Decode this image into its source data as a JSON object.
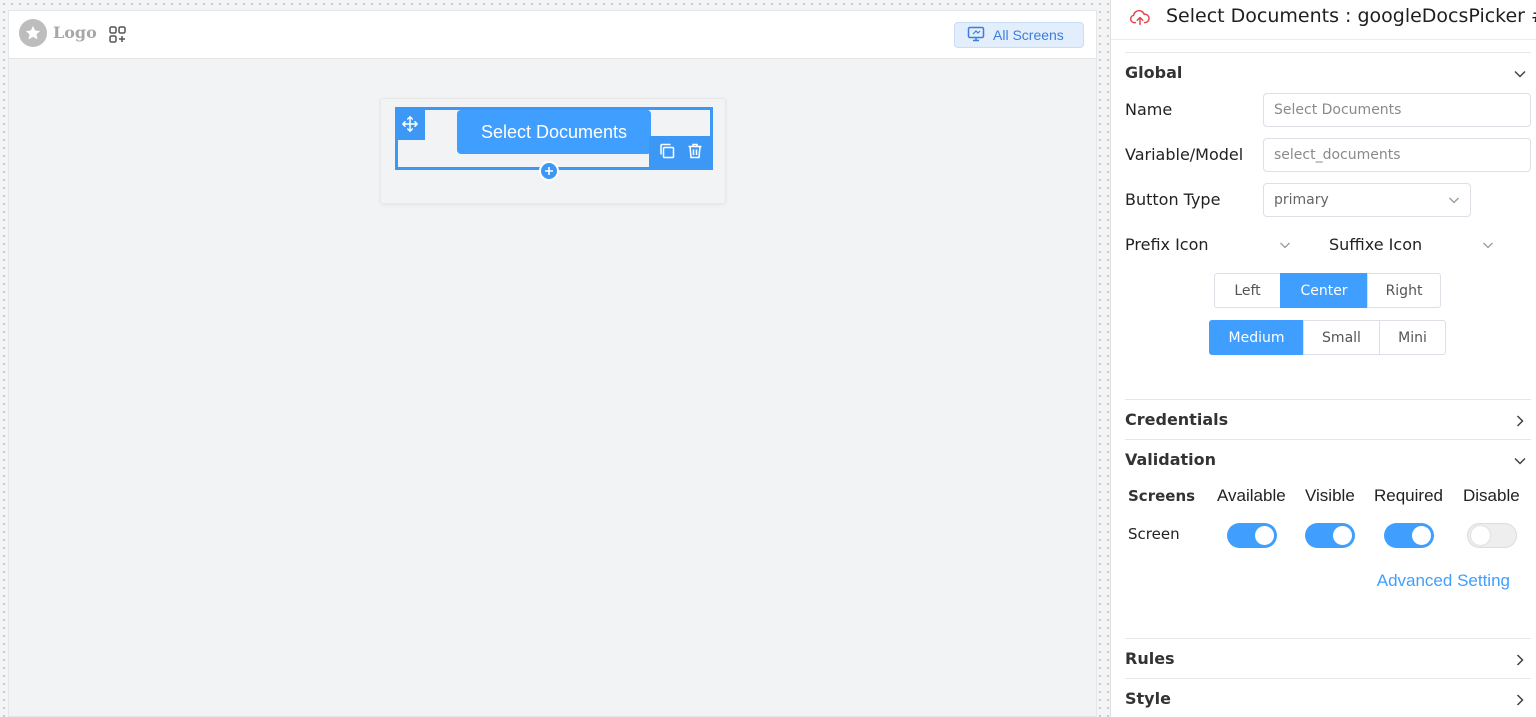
{
  "canvas": {
    "logo_text": "Logo",
    "all_screens_label": "All Screens",
    "widget_button_label": "Select Documents"
  },
  "panel": {
    "title": "Select Documents : googleDocsPicker #s",
    "global": {
      "header": "Global",
      "name_label": "Name",
      "name_placeholder": "Select Documents",
      "variable_label": "Variable/Model",
      "variable_placeholder": "select_documents",
      "button_type_label": "Button Type",
      "button_type_value": "primary",
      "prefix_icon_label": "Prefix Icon",
      "suffix_icon_label": "Suffixe Icon",
      "alignment_options": [
        "Left",
        "Center",
        "Right"
      ],
      "alignment_selected": "Center",
      "size_options": [
        "Medium",
        "Small",
        "Mini"
      ],
      "size_selected": "Medium"
    },
    "credentials_header": "Credentials",
    "validation": {
      "header": "Validation",
      "screens_label": "Screens",
      "columns": [
        "Available",
        "Visible",
        "Required",
        "Disable"
      ],
      "row_label": "Screen",
      "toggles": [
        true,
        true,
        true,
        false
      ],
      "advanced_link": "Advanced Setting"
    },
    "rules_header": "Rules",
    "style_header": "Style"
  },
  "colors": {
    "accent": "#409eff",
    "link": "#409eff"
  }
}
